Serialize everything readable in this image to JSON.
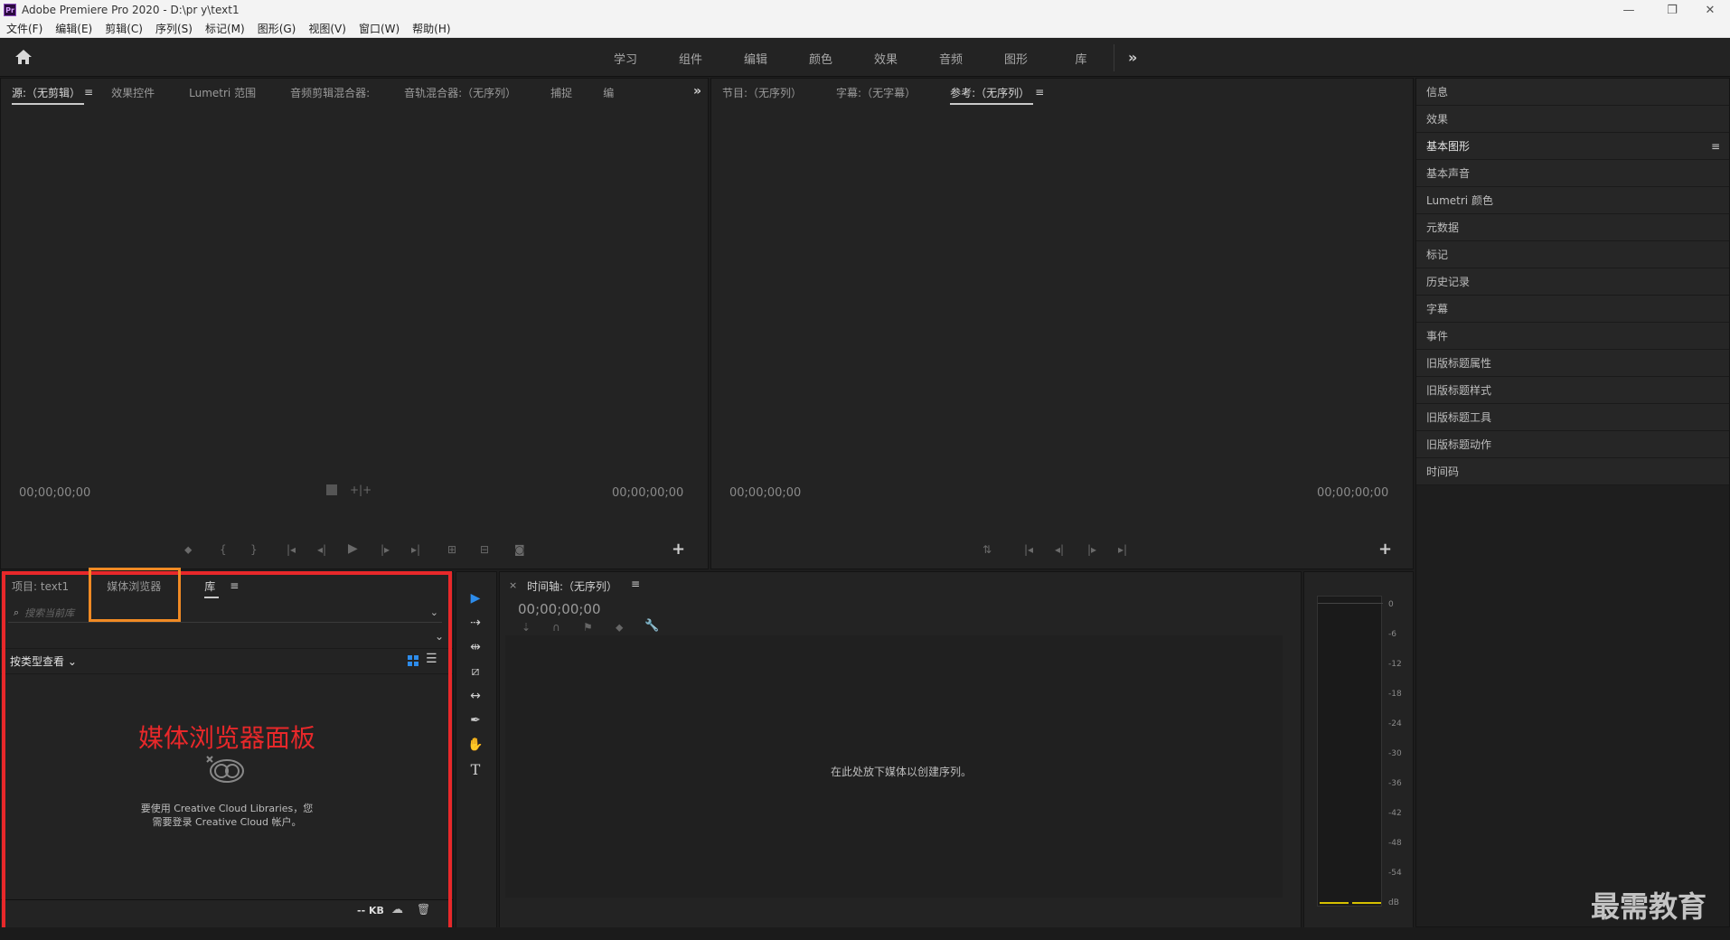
{
  "window": {
    "title": "Adobe Premiere Pro 2020 - D:\\pr y\\text1",
    "controls": [
      "—",
      "❐",
      "✕"
    ]
  },
  "menu": [
    "文件(F)",
    "编辑(E)",
    "剪辑(C)",
    "序列(S)",
    "标记(M)",
    "图形(G)",
    "视图(V)",
    "窗口(W)",
    "帮助(H)"
  ],
  "workspaces": [
    "学习",
    "组件",
    "编辑",
    "颜色",
    "效果",
    "音频",
    "图形",
    "库"
  ],
  "source_panel": {
    "tabs": [
      "源:（无剪辑）",
      "效果控件",
      "Lumetri 范围",
      "音频剪辑混合器:",
      "音轨混合器:（无序列）",
      "捕捉",
      "编"
    ],
    "timecode_left": "00;00;00;00",
    "timecode_right": "00;00;00;00"
  },
  "program_panel": {
    "tabs": [
      "节目:（无序列）",
      "字幕:（无字幕）",
      "参考:（无序列）"
    ],
    "timecode_left": "00;00;00;00",
    "timecode_right": "00;00;00;00"
  },
  "right_panel": {
    "items": [
      "信息",
      "效果",
      "基本图形",
      "基本声音",
      "Lumetri 颜色",
      "元数据",
      "标记",
      "历史记录",
      "字幕",
      "事件",
      "旧版标题属性",
      "旧版标题样式",
      "旧版标题工具",
      "旧版标题动作",
      "时间码"
    ]
  },
  "project_panel": {
    "tabs": [
      "项目: text1",
      "媒体浏览器",
      "库"
    ],
    "search_placeholder": "搜索当前库",
    "view_by": "按类型查看",
    "annotation": "媒体浏览器面板",
    "cc_message_line1": "要使用 Creative Cloud Libraries，您",
    "cc_message_line2": "需要登录 Creative Cloud 帐户。",
    "storage": "-- KB"
  },
  "timeline_panel": {
    "title": "时间轴:（无序列）",
    "close": "×",
    "timecode": "00;00;00;00",
    "drop_hint": "在此处放下媒体以创建序列。"
  },
  "audio_meter": {
    "scale": [
      "0",
      "-6",
      "-12",
      "-18",
      "-24",
      "-30",
      "-36",
      "-42",
      "-48",
      "-54",
      "dB"
    ]
  },
  "watermark": "最需教育",
  "colors": {
    "highlight_red": "#e8282a",
    "highlight_orange": "#f08a24",
    "selection_tool_blue": "#2d8ceb"
  }
}
